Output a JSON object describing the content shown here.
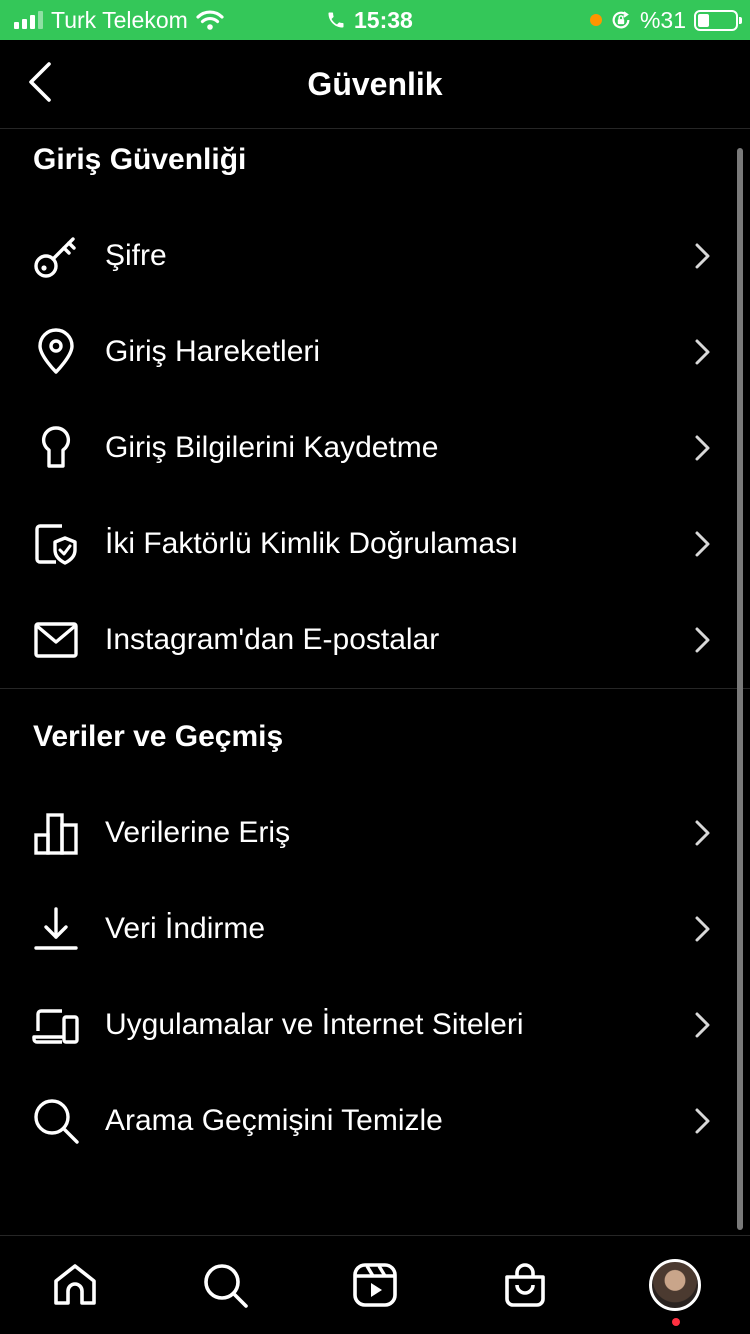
{
  "status_bar": {
    "carrier": "Turk Telekom",
    "time": "15:38",
    "battery_percent": "%31",
    "battery_level": 0.31,
    "color": "#34c759"
  },
  "header": {
    "title": "Güvenlik",
    "back_icon": "chevron-left-icon"
  },
  "sections": [
    {
      "title": "Giriş Güvenliği",
      "items": [
        {
          "label": "Şifre",
          "icon": "key-icon"
        },
        {
          "label": "Giriş Hareketleri",
          "icon": "location-pin-icon"
        },
        {
          "label": "Giriş Bilgilerini Kaydetme",
          "icon": "keyhole-icon"
        },
        {
          "label": "İki Faktörlü Kimlik Doğrulaması",
          "icon": "shield-check-icon"
        },
        {
          "label": "Instagram'dan E-postalar",
          "icon": "envelope-icon"
        }
      ]
    },
    {
      "title": "Veriler ve Geçmiş",
      "items": [
        {
          "label": "Verilerine Eriş",
          "icon": "bar-chart-icon"
        },
        {
          "label": "Veri İndirme",
          "icon": "download-icon"
        },
        {
          "label": "Uygulamalar ve İnternet Siteleri",
          "icon": "devices-icon"
        },
        {
          "label": "Arama Geçmişini Temizle",
          "icon": "search-icon"
        }
      ]
    }
  ],
  "tabbar": {
    "tabs": [
      "home-icon",
      "search-icon",
      "reels-icon",
      "shop-icon",
      "profile-avatar"
    ],
    "notification_color": "#ff3040"
  }
}
